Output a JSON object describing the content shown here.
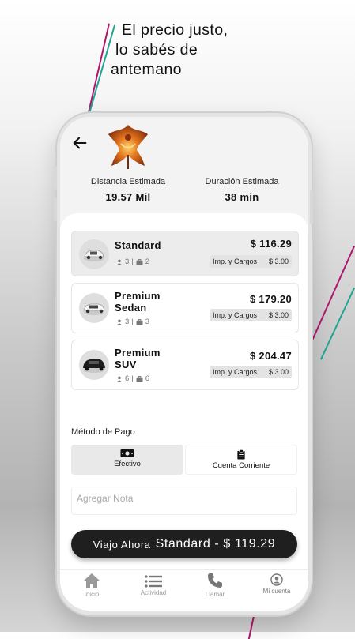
{
  "headline": {
    "line1": "El precio justo,",
    "line2": "lo sabés de",
    "line3": "antemano"
  },
  "trip": {
    "distance_label": "Distancia Estimada",
    "distance_value": "19.57 Mil",
    "duration_label": "Duración Estimada",
    "duration_value": "38 min"
  },
  "vehicles": [
    {
      "name_line1": "Standard",
      "name_line2": "",
      "passengers": "3",
      "bags": "2",
      "price": "$ 116.29",
      "tax_label": "Imp. y Cargos",
      "tax_value": "$ 3.00",
      "selected": true
    },
    {
      "name_line1": "Premium",
      "name_line2": "Sedan",
      "passengers": "3",
      "bags": "3",
      "price": "$ 179.20",
      "tax_label": "Imp. y Cargos",
      "tax_value": "$ 3.00",
      "selected": false
    },
    {
      "name_line1": "Premium",
      "name_line2": "SUV",
      "passengers": "6",
      "bags": "6",
      "price": "$ 204.47",
      "tax_label": "Imp. y Cargos",
      "tax_value": "$ 3.00",
      "selected": false
    }
  ],
  "payment": {
    "label": "Método de Pago",
    "options": [
      {
        "label": "Efectivo",
        "icon": "cash-icon",
        "selected": true
      },
      {
        "label": "Cuenta Corriente",
        "icon": "clipboard-icon",
        "selected": false
      }
    ]
  },
  "note": {
    "placeholder": "Agregar Nota"
  },
  "cta": {
    "prefix": "Viajo Ahora",
    "label": "Standard - $ 119.29"
  },
  "tabs": [
    {
      "label": "Inicio",
      "icon": "home-icon"
    },
    {
      "label": "Actividad",
      "icon": "list-icon"
    },
    {
      "label": "Llamar",
      "icon": "phone-icon"
    },
    {
      "label": "Mi cuenta",
      "icon": "account-icon"
    }
  ],
  "colors": {
    "magenta_line": "#b0166e",
    "teal_line": "#1fa592",
    "cta_bg": "#1f1f1f",
    "selected_bg": "#ececec"
  }
}
